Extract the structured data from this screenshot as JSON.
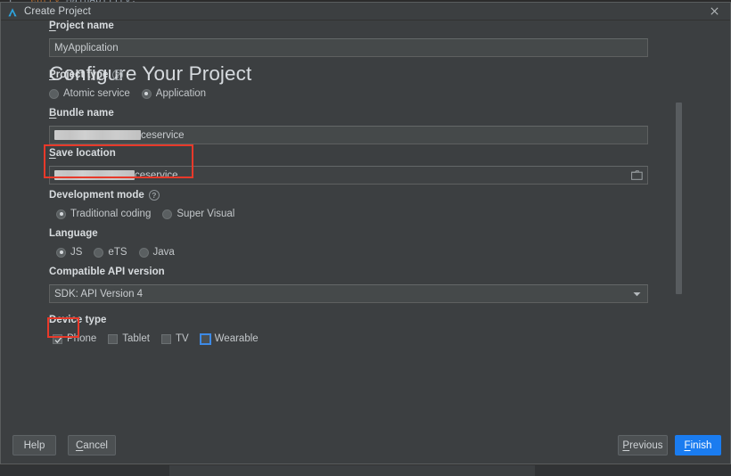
{
  "ide_background": {
    "code_line": "entry MainAbility;",
    "code_line_prefix": "1"
  },
  "window": {
    "title": "Create Project",
    "icon": "devecostudio-logo-icon",
    "close_icon": "close-icon"
  },
  "page": {
    "heading": "Configure Your Project"
  },
  "colors": {
    "accent": "#1a7cf0",
    "annotation": "#e8392a",
    "dialog_bg": "#3c3f41",
    "field_bg": "#45494a",
    "focus_ring": "#3d8ae5"
  },
  "fields": {
    "project_name": {
      "label": "Project name",
      "mnemonic": "P",
      "value": "MyApplication"
    },
    "project_type": {
      "label": "Project type",
      "mnemonic": "P",
      "help_icon": "help-circle-icon",
      "help_glyph": "?",
      "options": [
        {
          "label": "Atomic service",
          "selected": false
        },
        {
          "label": "Application",
          "selected": true
        }
      ],
      "annotated": true
    },
    "bundle_name": {
      "label": "Bundle name",
      "mnemonic": "B",
      "redacted": true,
      "value": "ceservice"
    },
    "save_location": {
      "label": "Save location",
      "mnemonic": "S",
      "redacted": true,
      "value": "ceservice",
      "browse_icon": "folder-icon"
    },
    "development_mode": {
      "label": "Development mode",
      "help_icon": "help-circle-icon",
      "help_glyph": "?",
      "options": [
        {
          "label": "Traditional coding",
          "selected": true
        },
        {
          "label": "Super Visual",
          "selected": false
        }
      ]
    },
    "language": {
      "label": "Language",
      "options": [
        {
          "label": "JS",
          "selected": true
        },
        {
          "label": "eTS",
          "selected": false
        },
        {
          "label": "Java",
          "selected": false
        }
      ],
      "annotated": true
    },
    "compatible_api_version": {
      "label": "Compatible API version",
      "value": "SDK: API Version 4",
      "dropdown_icon": "chevron-down-icon"
    },
    "device_type": {
      "label": "Device type",
      "options": [
        {
          "label": "Phone",
          "checked": true,
          "focused": false
        },
        {
          "label": "Tablet",
          "checked": false,
          "focused": false
        },
        {
          "label": "TV",
          "checked": false,
          "focused": false
        },
        {
          "label": "Wearable",
          "checked": false,
          "focused": true
        }
      ]
    }
  },
  "footer": {
    "help": {
      "label": "Help",
      "mnemonic": ""
    },
    "cancel": {
      "label": "ancel",
      "mnemonic": "C"
    },
    "previous": {
      "label": "revious",
      "mnemonic": "P"
    },
    "finish": {
      "label": "inish",
      "mnemonic": "F"
    }
  },
  "scrollbar": {
    "name": "vertical-scrollbar"
  }
}
